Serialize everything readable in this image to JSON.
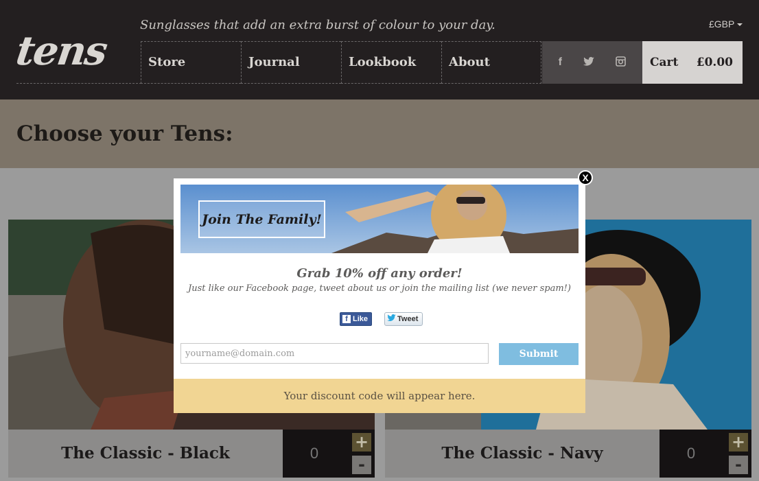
{
  "header": {
    "logo": "tens",
    "tagline": "Sunglasses that add an extra burst of colour to your day.",
    "currency": "£GBP",
    "nav": [
      {
        "label": "Store"
      },
      {
        "label": "Journal"
      },
      {
        "label": "Lookbook"
      },
      {
        "label": "About"
      }
    ],
    "social_icons": [
      "facebook-icon",
      "twitter-icon",
      "instagram-icon"
    ],
    "cart_label": "Cart",
    "cart_total": "£0.00"
  },
  "main": {
    "heading": "Choose your Tens:"
  },
  "products": [
    {
      "name": "The Classic - Black",
      "qty": "0",
      "plus": "+",
      "minus": "-"
    },
    {
      "name": "The Classic - Navy",
      "qty": "0",
      "plus": "+",
      "minus": "-"
    }
  ],
  "modal": {
    "close": "X",
    "banner_text": "Join The Family!",
    "headline": "Grab 10% off any order!",
    "subtext": "Just like our Facebook page, tweet about us or join the mailing list (we never spam!)",
    "like_label": "Like",
    "tweet_label": "Tweet",
    "email_placeholder": "yourname@domain.com",
    "submit_label": "Submit",
    "discount_text": "Your discount code will appear here."
  },
  "colors": {
    "header_bg": "#231f20",
    "overlay": "#9b9b9b",
    "submit": "#7fbde0",
    "discount_bg": "#f1d593"
  }
}
